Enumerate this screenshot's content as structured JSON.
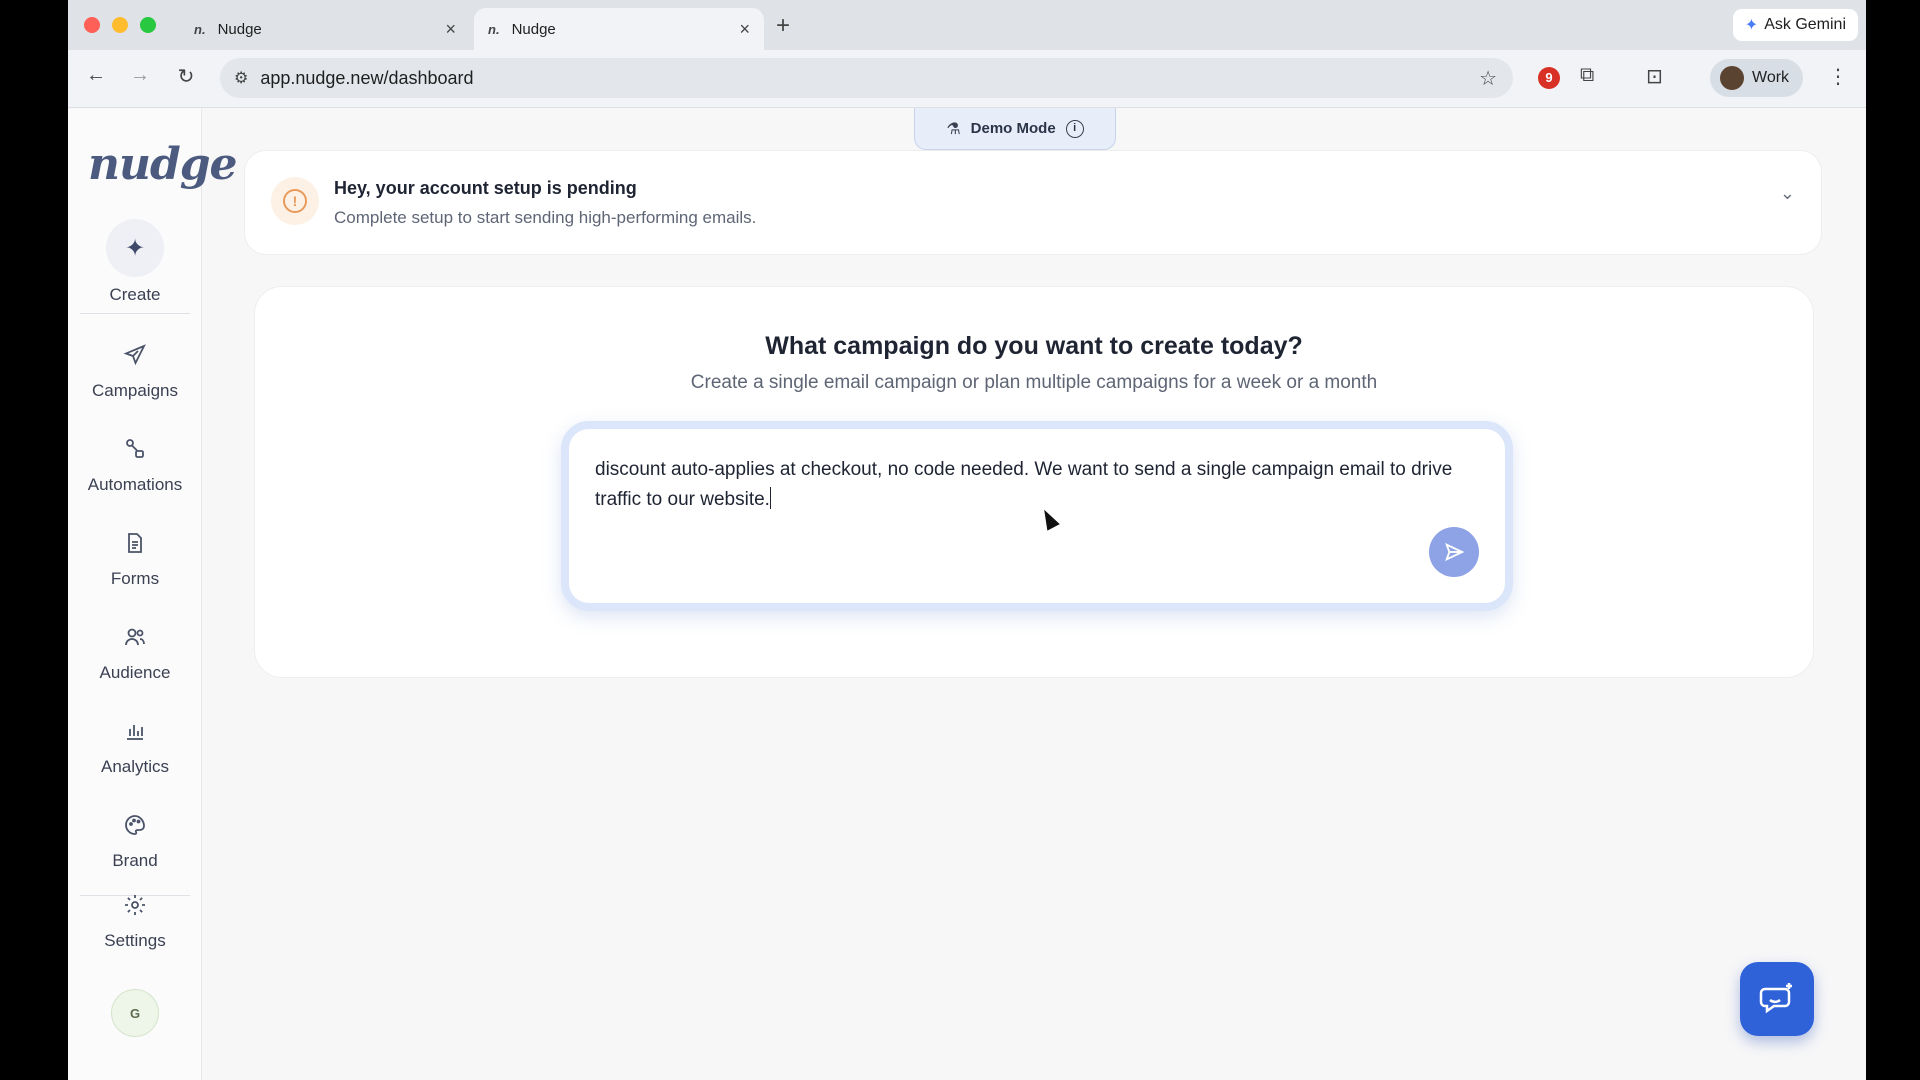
{
  "browser": {
    "tabs": [
      {
        "favicon": "n.",
        "title": "Nudge",
        "close": "×"
      },
      {
        "favicon": "n.",
        "title": "Nudge",
        "close": "×"
      }
    ],
    "new_tab": "+",
    "ask_gemini": "Ask Gemini",
    "url": "app.nudge.new/dashboard",
    "profile_label": "Work",
    "extension_badge": "9"
  },
  "sidebar": {
    "logo": "nudge",
    "create_label": "Create",
    "items": [
      {
        "label": "Campaigns",
        "icon": "send-icon"
      },
      {
        "label": "Automations",
        "icon": "flow-icon"
      },
      {
        "label": "Forms",
        "icon": "document-icon"
      },
      {
        "label": "Audience",
        "icon": "users-icon"
      },
      {
        "label": "Analytics",
        "icon": "bar-chart-icon"
      },
      {
        "label": "Brand",
        "icon": "palette-icon"
      },
      {
        "label": "Settings",
        "icon": "gear-icon"
      }
    ],
    "avatar_initial": "G"
  },
  "demo_mode": {
    "label": "Demo Mode"
  },
  "alert": {
    "title": "Hey, your account setup is pending",
    "subtitle": "Complete setup to start sending high-performing emails."
  },
  "campaign": {
    "title": "What campaign do you want to create today?",
    "subtitle": "Create a single email campaign or plan multiple campaigns for a week or a month",
    "prompt_value": "discount auto-applies at checkout, no code needed. We want to send a single campaign email to drive traffic to our website."
  },
  "colors": {
    "accent": "#2f62d9",
    "send_button": "#8ea3e6",
    "prompt_border": "#dbe6fb",
    "alert_icon": "#e89a5b"
  }
}
